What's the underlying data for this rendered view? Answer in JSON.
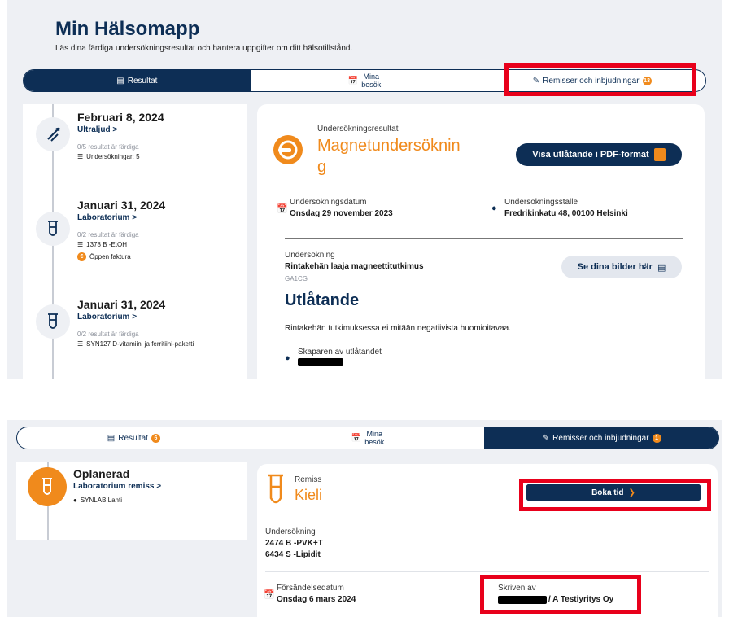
{
  "top": {
    "title": "Min Hälsomapp",
    "subtitle": "Läs dina färdiga undersökningsresultat och hantera uppgifter om ditt hälsotillstånd.",
    "tabs": [
      {
        "label": "Resultat",
        "badge": ""
      },
      {
        "label_line1": "Mina",
        "label_line2": "besök"
      },
      {
        "label": "Remisser och inbjudningar",
        "badge": "13"
      }
    ],
    "timeline": [
      {
        "date": "Februari 8, 2024",
        "category": "Ultraljud >",
        "status": "0/5 resultat är färdiga",
        "info": "Undersökningar: 5",
        "extra": ""
      },
      {
        "date": "Januari 31, 2024",
        "category": "Laboratorium >",
        "status": "0/2 resultat är färdiga",
        "info": "1378 B -EtOH",
        "extra": "Öppen faktura"
      },
      {
        "date": "Januari 31, 2024",
        "category": "Laboratorium >",
        "status": "0/2 resultat är färdiga",
        "info": "SYN127 D-vitamiini ja ferritiini-paketti",
        "extra": ""
      }
    ],
    "detail": {
      "type_label": "Undersökningsresultat",
      "title_line1": "Magnetundersöknin",
      "title_line2": "g",
      "pdf_button": "Visa utlåtande i PDF-format",
      "date_label": "Undersökningsdatum",
      "date_value": "Onsdag 29 november 2023",
      "place_label": "Undersökningsställe",
      "place_value": "Fredrikinkatu 48, 00100 Helsinki",
      "exam_label": "Undersökning",
      "exam_value": "Rintakehän laaja magneettitutkimus",
      "exam_code": "GA1CG",
      "images_button": "Se dina bilder här",
      "statement_heading": "Utlåtande",
      "statement_text": "Rintakehän tutkimuksessa ei mitään negatiivista huomioitavaa.",
      "author_label": "Skaparen av utlåtandet"
    }
  },
  "bottom": {
    "tabs": [
      {
        "label": "Resultat",
        "badge": "6"
      },
      {
        "label_line1": "Mina",
        "label_line2": "besök"
      },
      {
        "label": "Remisser och inbjudningar",
        "badge": "1"
      }
    ],
    "timeline": {
      "date": "Oplanerad",
      "category": "Laboratorium remiss >",
      "location": "SYNLAB Lahti"
    },
    "detail": {
      "type_label": "Remiss",
      "title": "Kieli",
      "book_button": "Boka tid",
      "exam_label": "Undersökning",
      "exam_line1": "2474 B -PVK+T",
      "exam_line2": "6434 S -Lipidit",
      "sent_label": "Försändelsedatum",
      "sent_value": "Onsdag 6 mars 2024",
      "written_label": "Skriven av",
      "written_value": "/ A Testiyritys Oy"
    }
  },
  "colors": {
    "navy": "#0d2e55",
    "orange": "#f08a1c",
    "highlight": "#e8001b"
  }
}
